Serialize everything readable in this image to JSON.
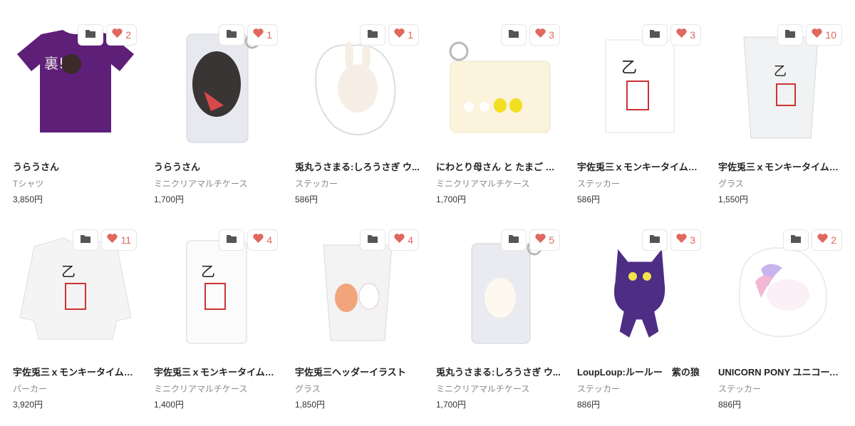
{
  "colors": {
    "heart": "#e0685e",
    "folder": "#555555"
  },
  "icons": {
    "folder": "folder-icon",
    "like": "heart-icon"
  },
  "products": [
    {
      "title": "うらうさん",
      "category": "Tシャツ",
      "price": "3,850円",
      "likes": "2"
    },
    {
      "title": "うらうさん",
      "category": "ミニクリアマルチケース",
      "price": "1,700円",
      "likes": "1"
    },
    {
      "title": "兎丸うさまる:しろうさぎ ウ...",
      "category": "ステッカー",
      "price": "586円",
      "likes": "1"
    },
    {
      "title": "にわとり母さん と たまご と ...",
      "category": "ミニクリアマルチケース",
      "price": "1,700円",
      "likes": "3"
    },
    {
      "title": "宇佐兎三ｘモンキータイム　...",
      "category": "ステッカー",
      "price": "586円",
      "likes": "3"
    },
    {
      "title": "宇佐兎三ｘモンキータイム　...",
      "category": "グラス",
      "price": "1,550円",
      "likes": "10"
    },
    {
      "title": "宇佐兎三ｘモンキータイム　...",
      "category": "パーカー",
      "price": "3,920円",
      "likes": "11"
    },
    {
      "title": "宇佐兎三ｘモンキータイム　...",
      "category": "ミニクリアマルチケース",
      "price": "1,400円",
      "likes": "4"
    },
    {
      "title": "宇佐兎三ヘッダーイラスト",
      "category": "グラス",
      "price": "1,850円",
      "likes": "4"
    },
    {
      "title": "兎丸うさまる:しろうさぎ ウ...",
      "category": "ミニクリアマルチケース",
      "price": "1,700円",
      "likes": "5"
    },
    {
      "title": "LoupLoup:ルールー　紫の狼",
      "category": "ステッカー",
      "price": "886円",
      "likes": "3"
    },
    {
      "title": "UNICORN PONY ユニコーン...",
      "category": "ステッカー",
      "price": "886円",
      "likes": "2"
    }
  ]
}
